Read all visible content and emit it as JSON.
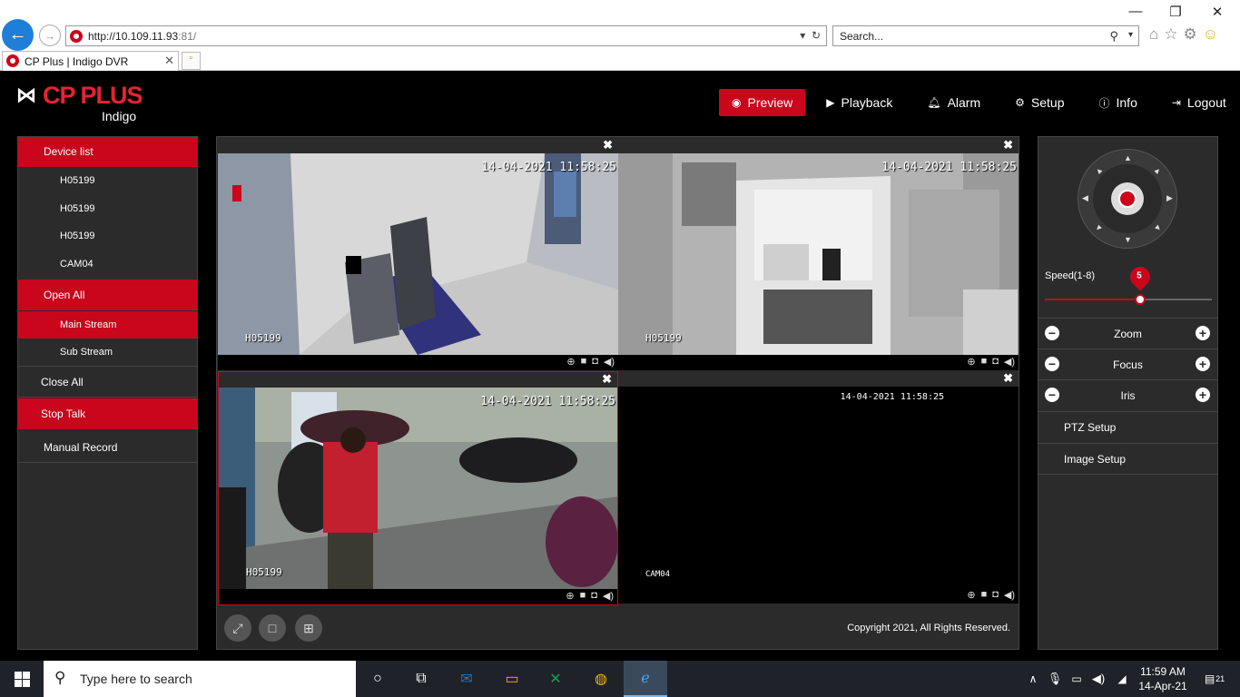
{
  "browser": {
    "url_host": "http://10.109.11.93",
    "url_port": ":81/",
    "search_placeholder": "Search...",
    "tab_title": "CP Plus | Indigo DVR"
  },
  "header": {
    "brand": "CP PLUS",
    "brand_sub": "Indigo",
    "nav": [
      {
        "label": "Preview"
      },
      {
        "label": "Playback"
      },
      {
        "label": "Alarm"
      },
      {
        "label": "Setup"
      },
      {
        "label": "Info"
      },
      {
        "label": "Logout"
      }
    ]
  },
  "left_panel": {
    "device_list": "Device list",
    "devices": [
      "H05199",
      "H05199",
      "H05199",
      "CAM04"
    ],
    "open_all": "Open All",
    "main_stream": "Main Stream",
    "sub_stream": "Sub Stream",
    "close_all": "Close All",
    "stop_talk": "Stop Talk",
    "manual_record": "Manual Record"
  },
  "cameras": [
    {
      "time": "14-04-2021 11:58:25",
      "name": "H05199"
    },
    {
      "time": "14-04-2021 11:58:25",
      "name": "H05199"
    },
    {
      "time": "14-04-2021 11:58:25",
      "name": "H05199"
    },
    {
      "time": "14-04-2021 11:58:25",
      "name": "CAM04"
    }
  ],
  "footer": {
    "copyright": "Copyright 2021, All Rights Reserved."
  },
  "right_panel": {
    "speed_label": "Speed(1-8)",
    "speed_value": "5",
    "speed_fraction": 0.57,
    "zoom": "Zoom",
    "focus": "Focus",
    "iris": "Iris",
    "ptz_setup": "PTZ Setup",
    "image_setup": "Image Setup"
  },
  "taskbar": {
    "search_placeholder": "Type here to search",
    "time": "11:59 AM",
    "date": "14-Apr-21",
    "notif_count": "21"
  },
  "colors": {
    "accent": "#c9061c",
    "panel": "#2b2b2b"
  }
}
